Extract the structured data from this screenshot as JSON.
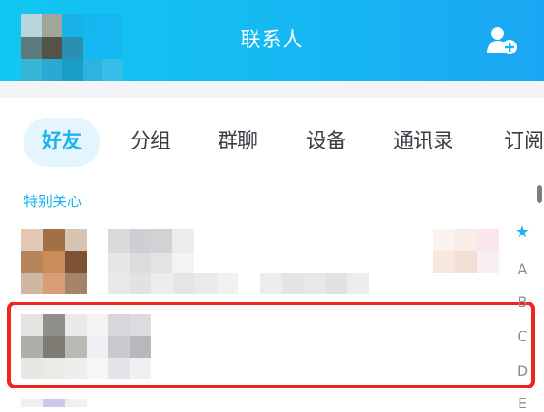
{
  "header": {
    "title": "联系人",
    "add_contact_icon": "add-contact-icon",
    "color": "#16b8f3"
  },
  "tabs": [
    {
      "label": "好友",
      "active": true
    },
    {
      "label": "分组",
      "active": false
    },
    {
      "label": "群聊",
      "active": false
    },
    {
      "label": "设备",
      "active": false
    },
    {
      "label": "通讯录",
      "active": false
    },
    {
      "label": "订阅",
      "active": false
    }
  ],
  "section": {
    "title": "特别关心"
  },
  "index_bar": {
    "letters": [
      "★",
      "A",
      "B",
      "C",
      "D",
      "E"
    ]
  },
  "accent_color": "#1cb4ee",
  "highlight_color": "#f0251f"
}
